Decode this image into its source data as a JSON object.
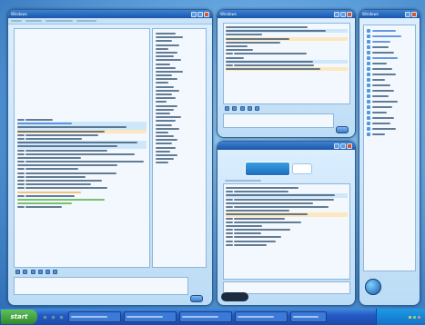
{
  "main_window": {
    "title": "Windows"
  },
  "top_window": {
    "title": "Windows"
  },
  "right_window": {
    "title": "Windows"
  },
  "bottom_window": {
    "title": ""
  },
  "taskbar": {
    "start_label": "start",
    "clock": ""
  },
  "colors": {
    "titlebar": "#1c56a8",
    "taskbar": "#2459c4",
    "start": "#2e8b2e",
    "accent_orange": "#f0b050",
    "accent_green": "#4fae3a"
  }
}
